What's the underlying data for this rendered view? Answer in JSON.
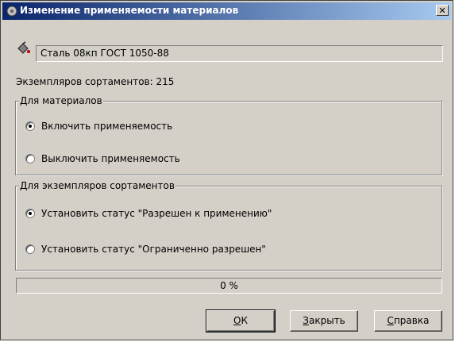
{
  "window": {
    "title": "Изменение применяемости материалов"
  },
  "material": {
    "value": "Сталь 08кп ГОСТ 1050-88",
    "icon": "material-bucket-icon"
  },
  "count_line": "Экземпляров сортаментов: 215",
  "group_materials": {
    "label": "Для материалов",
    "options": [
      {
        "label": "Включить применяемость",
        "selected": true
      },
      {
        "label": "Выключить применяемость",
        "selected": false
      }
    ]
  },
  "group_instances": {
    "label": "Для экземпляров сортаментов",
    "options": [
      {
        "label": "Установить статус \"Разрешен к применению\"",
        "selected": true
      },
      {
        "label": "Установить статус \"Ограниченно разрешен\"",
        "selected": false
      }
    ]
  },
  "progress": {
    "text": "0 %",
    "fraction": 0
  },
  "buttons": {
    "ok": {
      "label": "ОК",
      "underline": "О",
      "rest": "К"
    },
    "close": {
      "label": "Закрыть",
      "underline": "З",
      "rest": "акрыть"
    },
    "help": {
      "label": "Справка",
      "underline": "С",
      "rest": "правка"
    }
  },
  "colors": {
    "titlebar_start": "#0a246a",
    "titlebar_end": "#a6caf0",
    "dialog_bg": "#d4d0c8"
  }
}
